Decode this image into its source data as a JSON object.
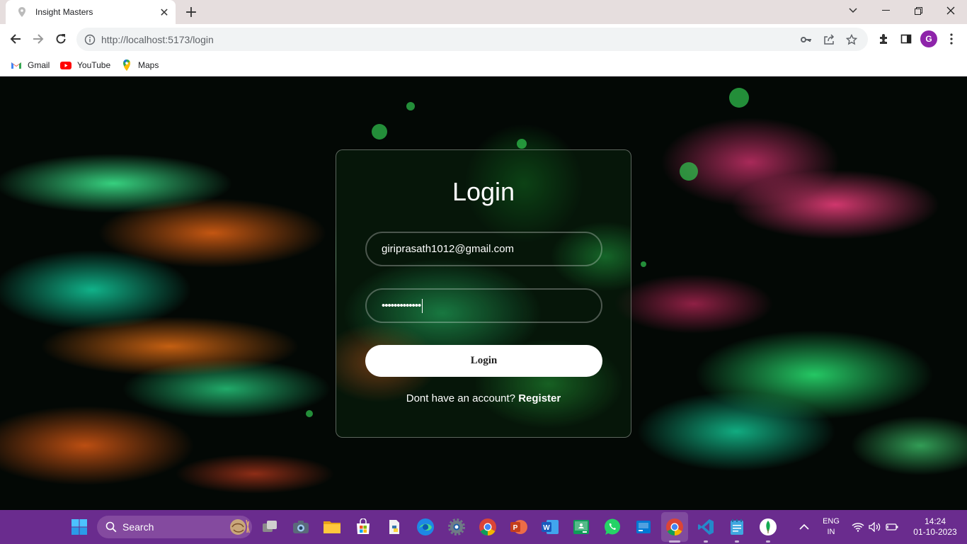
{
  "browser": {
    "tab_title": "Insight Masters",
    "url": "http://localhost:5173/login",
    "profile_initial": "G",
    "bookmarks": [
      {
        "label": "Gmail",
        "icon": "gmail-icon"
      },
      {
        "label": "YouTube",
        "icon": "youtube-icon"
      },
      {
        "label": "Maps",
        "icon": "maps-icon"
      }
    ]
  },
  "login": {
    "title": "Login",
    "email_value": "giriprasath1012@gmail.com",
    "password_masked": "•••••••••••••",
    "button_label": "Login",
    "register_prompt": "Dont have an account?",
    "register_link": "Register"
  },
  "taskbar": {
    "search_label": "Search",
    "language": "ENG",
    "region": "IN",
    "time": "14:24",
    "date": "01-10-2023",
    "apps": [
      "start-icon",
      "task-view-icon",
      "camera-icon",
      "file-explorer-icon",
      "store-icon",
      "python-app-icon",
      "edge-icon",
      "settings-icon",
      "chrome-icon",
      "powerpoint-icon",
      "word-icon",
      "classroom-icon",
      "whatsapp-icon",
      "app-icon",
      "chrome-active-icon",
      "vscode-icon",
      "notepad-icon",
      "mongodb-icon"
    ]
  },
  "colors": {
    "taskbar_bg": "#6a2c8e",
    "tabstrip_bg": "#e6dede",
    "profile_bg": "#8e24aa",
    "login_button_bg": "#ffffff"
  }
}
